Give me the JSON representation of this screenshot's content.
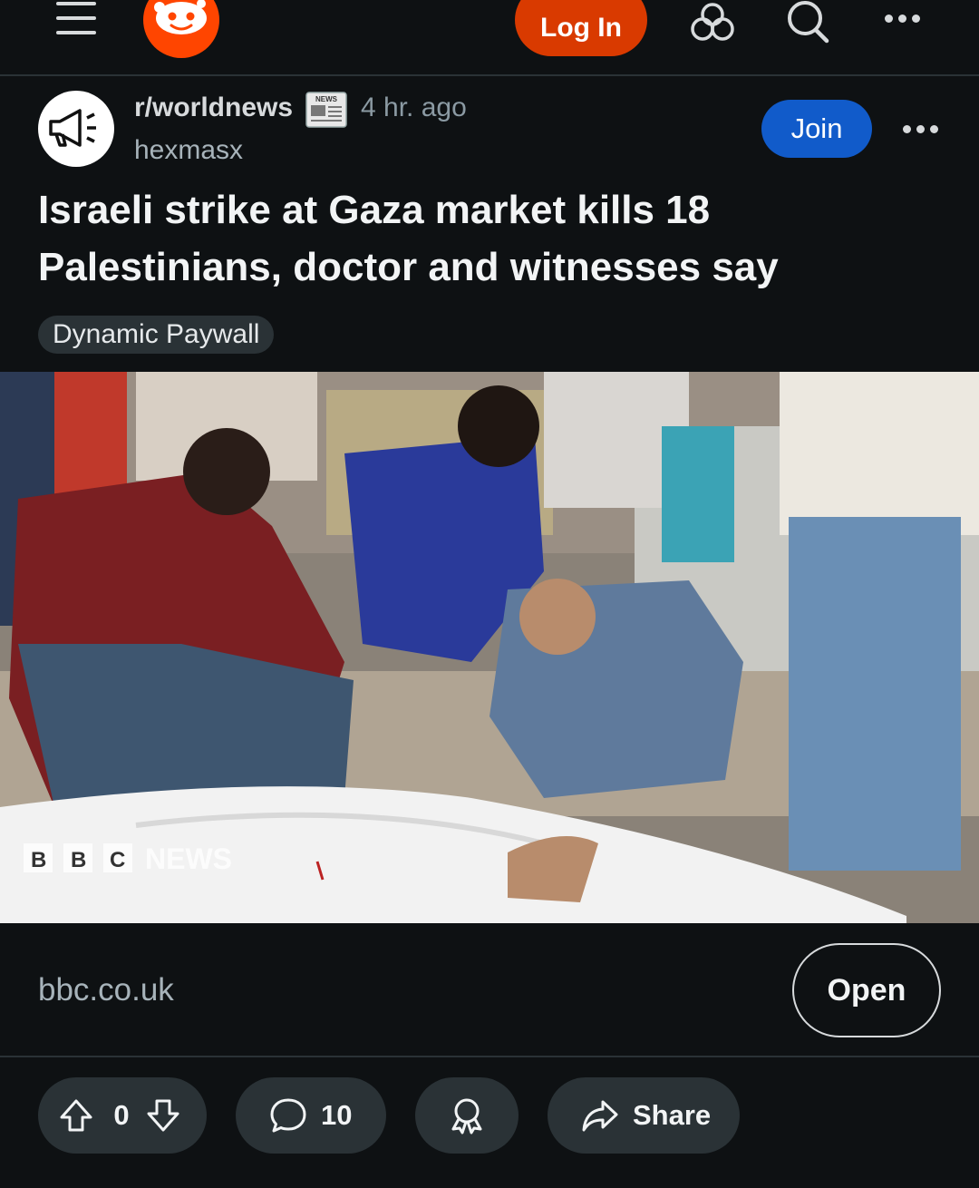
{
  "header": {
    "menu_icon": "hamburger-menu-icon",
    "logo": "reddit-snoo-logo",
    "login_label": "Log In",
    "icons": [
      "chat-icon",
      "search-icon",
      "more-options-icon"
    ],
    "accent_color": "#d93a00"
  },
  "post": {
    "subreddit": "r/worldnews",
    "news_badge_text": "NEWS",
    "time_ago": "4 hr. ago",
    "author": "hexmasx",
    "join_label": "Join",
    "title": "Israeli strike at Gaza market kills 18 Palestinians, doctor and witnesses say",
    "flair": "Dynamic Paywall",
    "image_watermark": "BBC NEWS",
    "domain": "bbc.co.uk",
    "open_label": "Open"
  },
  "actions": {
    "score": "0",
    "comments": "10",
    "share_label": "Share"
  },
  "colors": {
    "background": "#0e1113",
    "join_button": "#115bca",
    "pill_background": "#2a3236"
  }
}
